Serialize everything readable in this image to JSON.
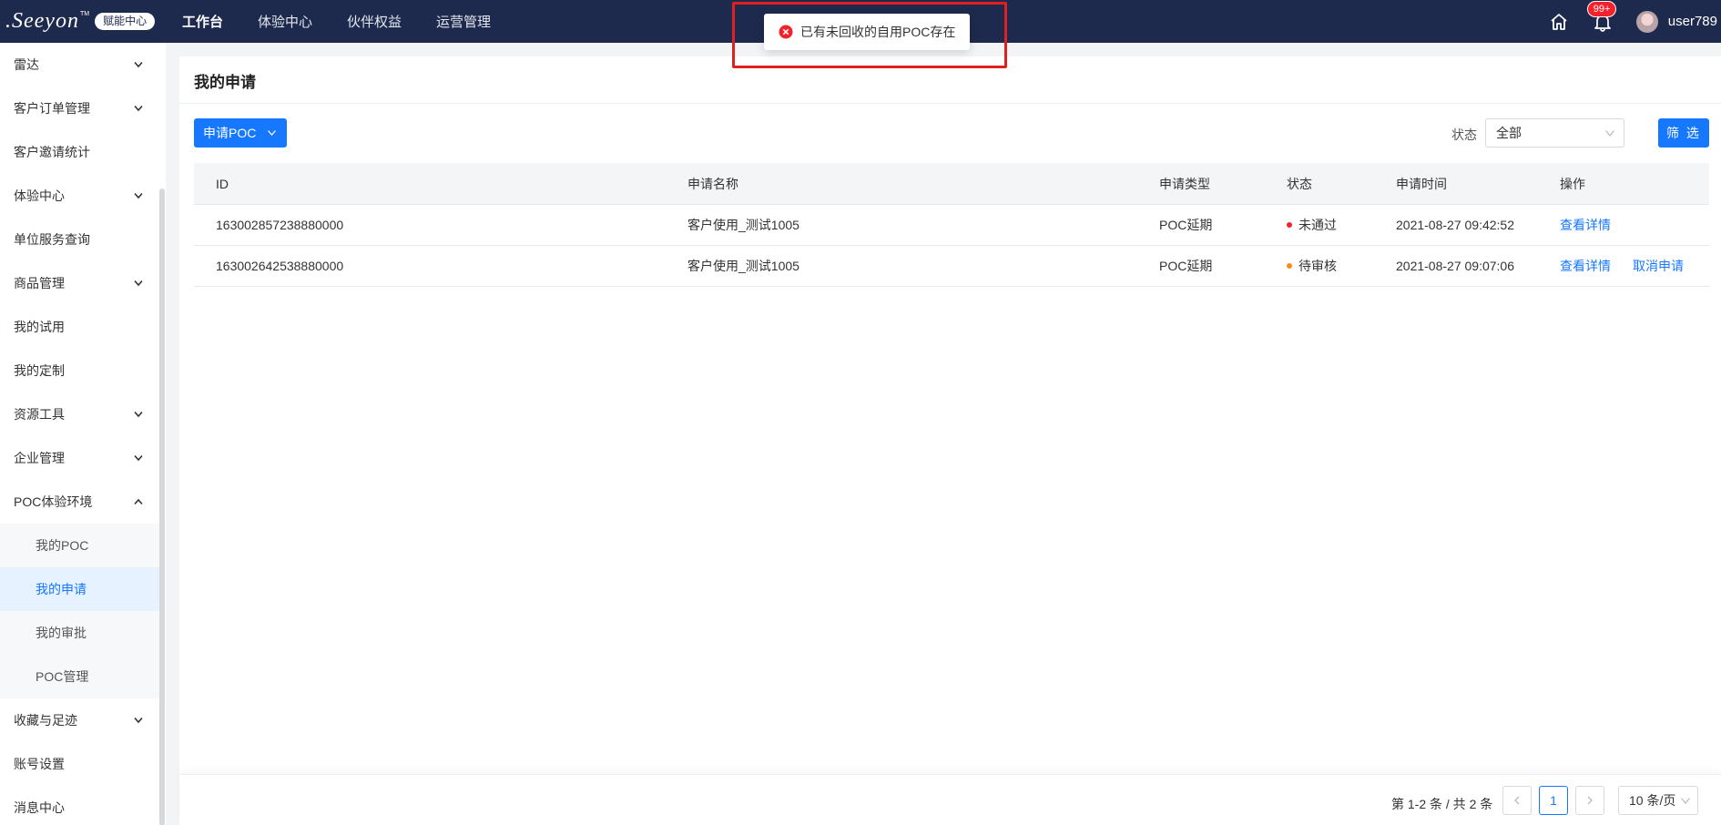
{
  "brand": {
    "logo_text": ".Seeyon",
    "logo_tm": "TM",
    "badge": "赋能中心"
  },
  "topnav": {
    "items": [
      "工作台",
      "体验中心",
      "伙伴权益",
      "运营管理"
    ],
    "active_index": 0,
    "notification_count": "99+",
    "username": "user789",
    "home_icon": "home-icon",
    "bell_icon": "bell-icon"
  },
  "sidebar": {
    "items": [
      {
        "label": "雷达",
        "chevron": "down"
      },
      {
        "label": "客户订单管理",
        "chevron": "down"
      },
      {
        "label": "客户邀请统计"
      },
      {
        "label": "体验中心",
        "chevron": "down"
      },
      {
        "label": "单位服务查询"
      },
      {
        "label": "商品管理",
        "chevron": "down"
      },
      {
        "label": "我的试用"
      },
      {
        "label": "我的定制"
      },
      {
        "label": "资源工具",
        "chevron": "down"
      },
      {
        "label": "企业管理",
        "chevron": "down"
      },
      {
        "label": "POC体验环境",
        "chevron": "up"
      },
      {
        "label": "我的POC",
        "sub": true
      },
      {
        "label": "我的申请",
        "sub": true,
        "selected": true
      },
      {
        "label": "我的审批",
        "sub": true
      },
      {
        "label": "POC管理",
        "sub": true
      },
      {
        "label": "收藏与足迹",
        "chevron": "down"
      },
      {
        "label": "账号设置"
      },
      {
        "label": "消息中心"
      }
    ]
  },
  "page": {
    "title": "我的申请",
    "apply_button": "申请POC",
    "status_label": "状态",
    "status_value": "全部",
    "filter_button": "筛 选"
  },
  "table": {
    "columns": [
      "ID",
      "申请名称",
      "申请类型",
      "状态",
      "申请时间",
      "操作"
    ],
    "rows": [
      {
        "id": "163002857238880000",
        "name": "客户使用_测试1005",
        "type": "POC延期",
        "status": "未通过",
        "status_color": "#f5222d",
        "time": "2021-08-27 09:42:52",
        "actions": [
          "查看详情"
        ]
      },
      {
        "id": "163002642538880000",
        "name": "客户使用_测试1005",
        "type": "POC延期",
        "status": "待审核",
        "status_color": "#fa8c16",
        "time": "2021-08-27 09:07:06",
        "actions": [
          "查看详情",
          "取消申请"
        ]
      }
    ]
  },
  "pagination": {
    "total_text": "第 1-2 条 / 共 2 条",
    "current_page": "1",
    "page_size": "10 条/页"
  },
  "toast": {
    "message": "已有未回收的自用POC存在",
    "icon": "error-circle-icon",
    "icon_color": "#f5222d"
  },
  "colors": {
    "nav_bg": "#1e2a4d",
    "primary": "#1677ff",
    "highlight": "#e02020"
  }
}
